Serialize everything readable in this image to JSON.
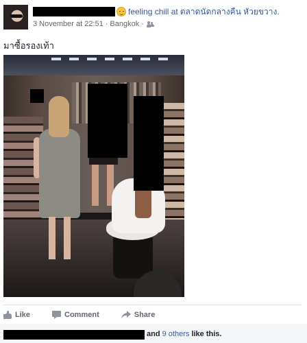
{
  "post": {
    "feeling": "feeling chill at",
    "place": "ตลาดนัดกลางคืน หัวยขวาง.",
    "timestamp": "3 November at 22:51",
    "separator": "·",
    "location": "Bangkok",
    "separator2": "·",
    "audience_icon": "friends-icon",
    "feeling_icon": "relieved-face-icon",
    "text": "มาซื้อรองเท้า"
  },
  "actions": {
    "like": "Like",
    "comment": "Comment",
    "share": "Share"
  },
  "likes": {
    "and": "and",
    "others": "9 others",
    "suffix": "like this."
  },
  "colors": {
    "link": "#365899",
    "meta": "#616770",
    "action": "#606770",
    "bar_bg": "#f6f7f9"
  }
}
